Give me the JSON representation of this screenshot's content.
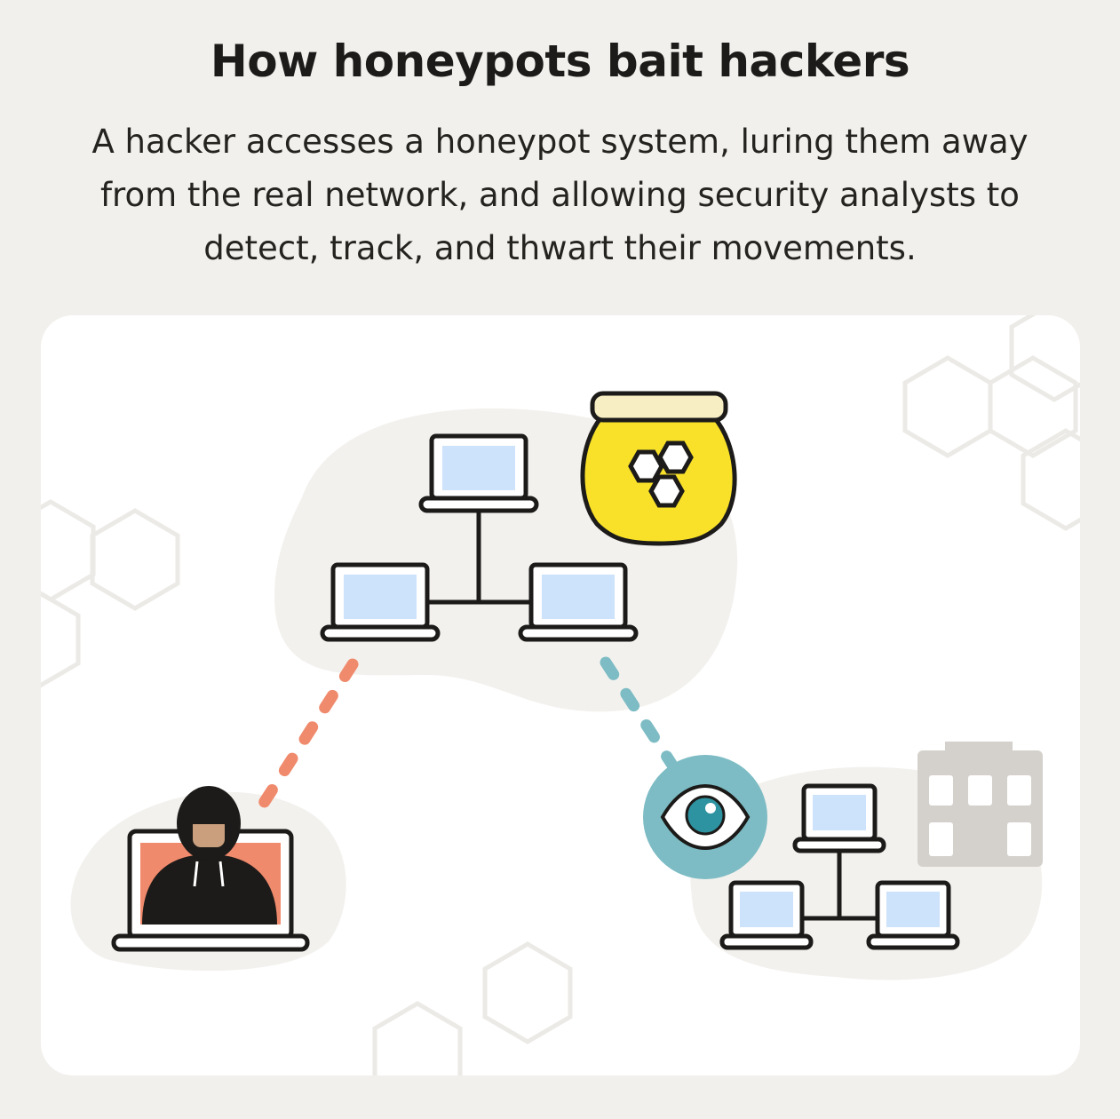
{
  "header": {
    "title": "How honeypots bait hackers",
    "subtitle": "A hacker accesses a honeypot system, luring them away from the real network, and allowing security analysts to detect, track, and thwart their movements."
  },
  "diagram": {
    "nodes": [
      {
        "name": "honeypot-network",
        "icon": "laptop-network-icon",
        "count": 3
      },
      {
        "name": "honeypot",
        "icon": "honey-jar-icon"
      },
      {
        "name": "hacker",
        "icon": "hooded-hacker-laptop-icon"
      },
      {
        "name": "security-analyst",
        "icon": "eye-icon"
      },
      {
        "name": "real-network",
        "icon": "laptop-network-icon",
        "count": 3
      },
      {
        "name": "organization",
        "icon": "building-icon"
      }
    ],
    "edges": [
      {
        "from": "hacker",
        "to": "honeypot-network",
        "style": "dashed",
        "color": "#f08a6c"
      },
      {
        "from": "security-analyst",
        "to": "honeypot-network",
        "style": "dashed",
        "color": "#7dbcc4"
      }
    ],
    "colors": {
      "background": "#f2f0ed",
      "panel": "#ffffff",
      "blob": "#f3f1ee",
      "screen": "#cde2fb",
      "honey": "#f9e12a",
      "jar_lid": "#f7eec3",
      "hacker_line": "#f08a6c",
      "eye_badge": "#7dbcc4",
      "eye_iris": "#2e93a1",
      "building": "#d4d1cc",
      "outline": "#1c1b19"
    }
  }
}
